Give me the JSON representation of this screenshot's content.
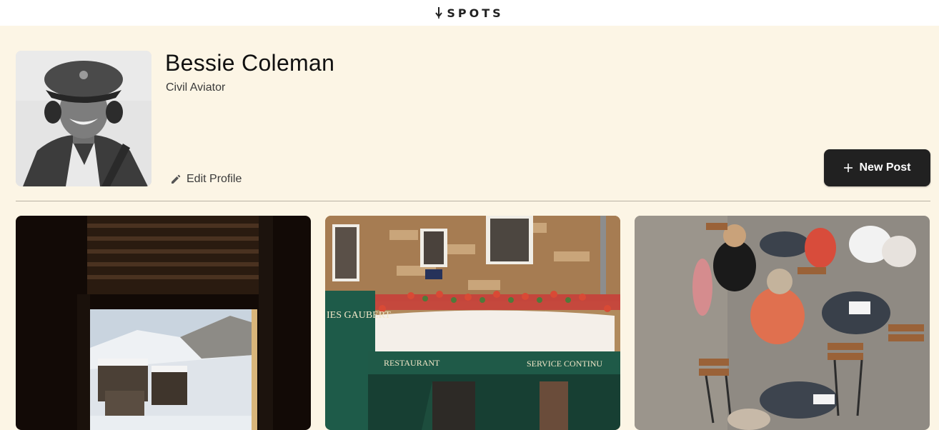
{
  "header": {
    "logo_text": "SPOTS",
    "logo_icon": "spots-logo-icon"
  },
  "profile": {
    "name": "Bessie Coleman",
    "role": "Civil Aviator",
    "avatar_icon": "avatar-photo",
    "edit_label": "Edit Profile",
    "edit_icon": "pencil-icon"
  },
  "actions": {
    "new_post_label": "New Post",
    "new_post_icon": "plus-icon"
  },
  "cards": [
    {
      "image_name": "window-mountain-village-photo"
    },
    {
      "image_name": "restaurant-storefront-photo",
      "signs": [
        "RESTAURANT",
        "SERVICE CONTINU",
        "IES GAUBERT"
      ]
    },
    {
      "image_name": "outdoor-cafe-terrace-photo"
    }
  ],
  "colors": {
    "background": "#fcf5e5",
    "topbar": "#ffffff",
    "button_bg": "#212121",
    "button_text": "#ffffff",
    "text_primary": "#212121"
  }
}
